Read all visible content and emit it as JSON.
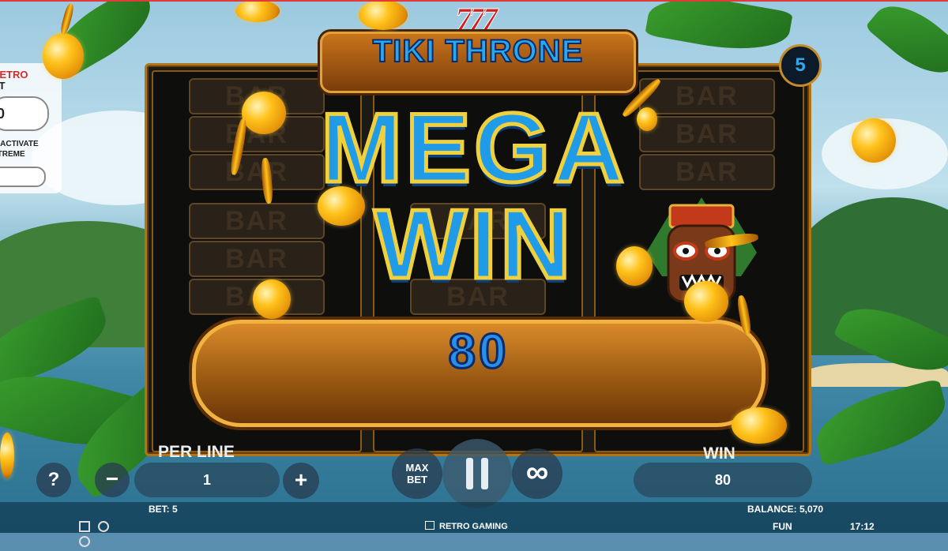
{
  "game": {
    "title": "TIKI THRONE",
    "logo_sevens": "777",
    "lines_count": "5"
  },
  "symbol": {
    "bar_label": "BAR"
  },
  "win_overlay": {
    "line1": "MEGA",
    "line2": "WIN",
    "amount": "80"
  },
  "side_panel": {
    "brand_label": "RETRO",
    "bet_label": "ET",
    "value": "0",
    "activate_line1": "O ACTIVATE",
    "activate_line2": "XTREME"
  },
  "controls": {
    "help_label": "?",
    "per_line_label": "PER LINE",
    "per_line_value": "1",
    "minus_label": "−",
    "plus_label": "+",
    "max_bet_line1": "MAX",
    "max_bet_line2": "BET",
    "pause_icon": "pause-icon",
    "autoplay_label": "∞",
    "win_label": "WIN",
    "win_value": "80"
  },
  "status_bar": {
    "bet": "BET: 5",
    "balance": "BALANCE: 5,070",
    "brand": "RETRO GAMING",
    "mode": "FUN",
    "time": "17:12"
  },
  "colors": {
    "accent_blue": "#1f9be8",
    "gold": "#f2b23e",
    "frame_brown": "#7a3d0a"
  }
}
